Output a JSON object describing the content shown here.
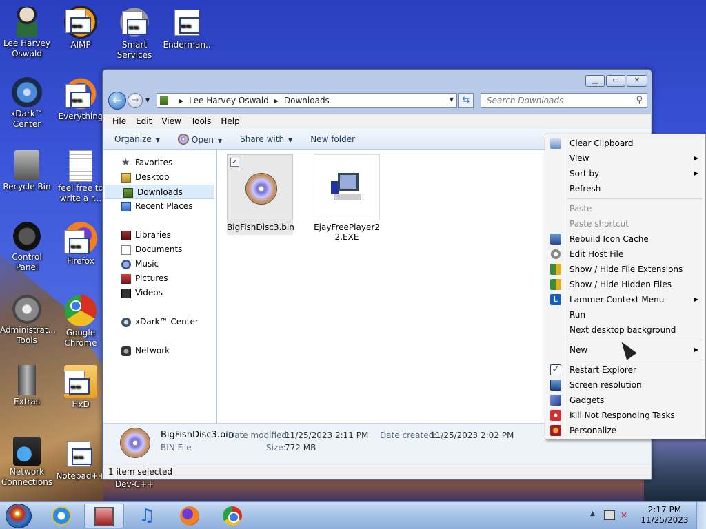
{
  "desktop": {
    "icons": [
      {
        "label": "Lee Harvey Oswald"
      },
      {
        "label": "AIMP"
      },
      {
        "label": "Smart Services"
      },
      {
        "label": "Enderman..."
      },
      {
        "label": "xDark™ Center"
      },
      {
        "label": "Everything"
      },
      {
        "label": "Recycle Bin"
      },
      {
        "label": "feel free to write a r..."
      },
      {
        "label": "Control Panel"
      },
      {
        "label": "Firefox"
      },
      {
        "label": "Administrat... Tools"
      },
      {
        "label": "Google Chrome"
      },
      {
        "label": "Extras"
      },
      {
        "label": "HxD"
      },
      {
        "label": "Network Connections"
      },
      {
        "label": "Notepad++"
      },
      {
        "label": "Dev-C++"
      }
    ]
  },
  "explorer": {
    "breadcrumb": [
      "Lee Harvey Oswald",
      "Downloads"
    ],
    "search_placeholder": "Search Downloads",
    "menu": [
      "File",
      "Edit",
      "View",
      "Tools",
      "Help"
    ],
    "toolbar": {
      "organize": "Organize",
      "open": "Open",
      "share": "Share with",
      "new_folder": "New folder"
    },
    "sidebar": {
      "favorites": "Favorites",
      "desktop": "Desktop",
      "downloads": "Downloads",
      "recent": "Recent Places",
      "libraries": "Libraries",
      "documents": "Documents",
      "music": "Music",
      "pictures": "Pictures",
      "videos": "Videos",
      "xdark": "xDark™ Center",
      "network": "Network"
    },
    "files": [
      {
        "name": "BigFishDisc3.bin",
        "selected": true
      },
      {
        "name": "EjayFreePlayer22.EXE",
        "selected": false
      }
    ],
    "details": {
      "name": "BigFishDisc3.bin",
      "type": "BIN File",
      "modified_label": "Date modified:",
      "modified": "11/25/2023 2:11 PM",
      "created_label": "Date created:",
      "created": "11/25/2023 2:02 PM",
      "size_label": "Size:",
      "size": "772 MB"
    },
    "status": "1 item selected"
  },
  "context_menu": {
    "clear_clipboard": "Clear Clipboard",
    "view": "View",
    "sort_by": "Sort by",
    "refresh": "Refresh",
    "paste": "Paste",
    "paste_shortcut": "Paste shortcut",
    "rebuild_icon_cache": "Rebuild Icon Cache",
    "edit_host_file": "Edit Host File",
    "show_hide_ext": "Show / Hide File Extensions",
    "show_hide_hidden": "Show / Hide Hidden Files",
    "lammer": "Lammer Context Menu",
    "run": "Run",
    "next_bg": "Next desktop background",
    "new": "New",
    "restart_explorer": "Restart Explorer",
    "screen_resolution": "Screen resolution",
    "gadgets": "Gadgets",
    "kill_tasks": "Kill Not Responding Tasks",
    "personalize": "Personalize"
  },
  "taskbar": {
    "time": "2:17 PM",
    "date": "11/25/2023"
  }
}
